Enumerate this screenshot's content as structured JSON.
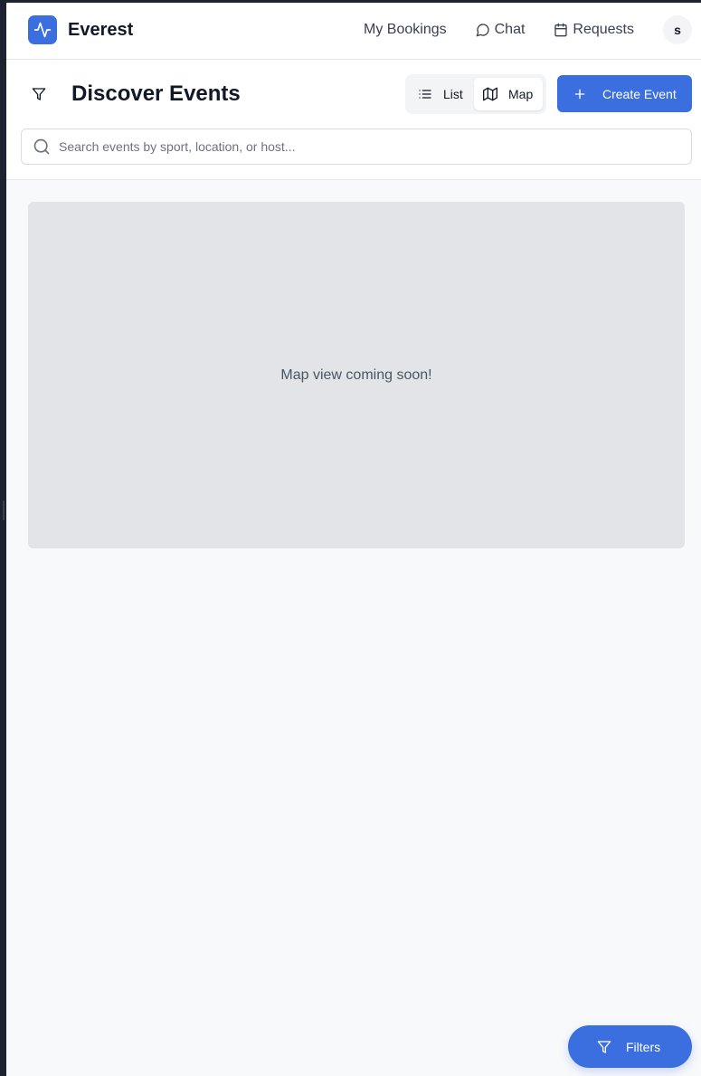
{
  "brand": {
    "name": "Everest",
    "logo_icon": "activity-pulse-icon",
    "accent": "#3b6fe0"
  },
  "nav": {
    "bookings": "My Bookings",
    "chat": "Chat",
    "requests": "Requests",
    "avatar_initial": "s"
  },
  "header": {
    "title": "Discover Events",
    "view_toggle": {
      "list_label": "List",
      "map_label": "Map",
      "selected": "Map"
    },
    "create_label": "Create Event"
  },
  "search": {
    "placeholder": "Search events by sport, location, or host...",
    "value": ""
  },
  "map": {
    "message": "Map view coming soon!"
  },
  "fab": {
    "filters_label": "Filters"
  }
}
